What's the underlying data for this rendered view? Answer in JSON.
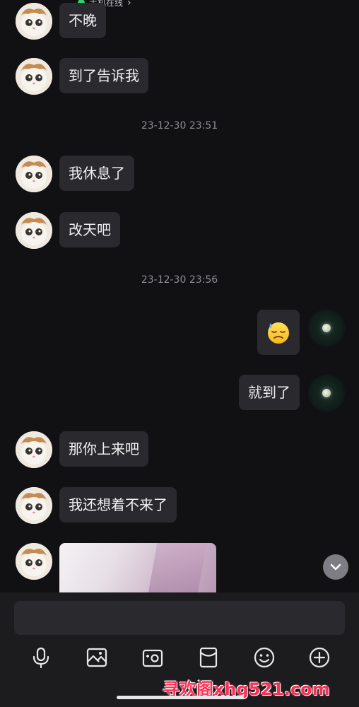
{
  "header": {
    "status": "手机在线"
  },
  "messages": [
    {
      "side": "left",
      "text": "不晚"
    },
    {
      "side": "left",
      "text": "到了告诉我"
    },
    {
      "type": "time",
      "text": "23-12-30 23:51"
    },
    {
      "side": "left",
      "text": "我休息了"
    },
    {
      "side": "left",
      "text": "改天吧"
    },
    {
      "type": "time",
      "text": "23-12-30 23:56"
    },
    {
      "side": "right",
      "emoji": "downcast-face-with-sweat"
    },
    {
      "side": "right",
      "text": "就到了"
    },
    {
      "side": "left",
      "text": "那你上来吧"
    },
    {
      "side": "left",
      "text": "我还想着不来了"
    },
    {
      "side": "left",
      "type": "image"
    }
  ],
  "toolbar": {
    "icons": [
      "microphone-icon",
      "image-icon",
      "camera-icon",
      "red-packet-icon",
      "emoji-icon",
      "plus-icon"
    ]
  },
  "watermark": "寻欢阁xhg521.com",
  "colors": {
    "background": "#111114",
    "bubble": "#2a2a2e",
    "online": "#2bd76a",
    "watermark": "#ff2e55"
  }
}
